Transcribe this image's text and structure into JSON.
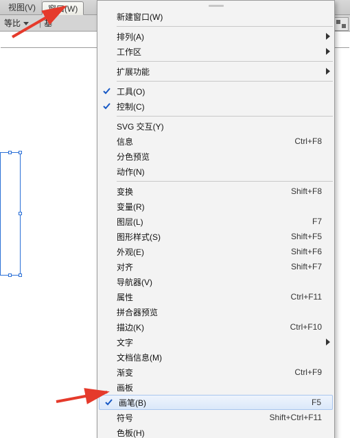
{
  "menubar": {
    "tabs": [
      {
        "label": "视图(V)",
        "active": false
      },
      {
        "label": "窗口(W)",
        "active": true
      }
    ]
  },
  "optbar": {
    "field1_label": "等比",
    "field2_label": "基"
  },
  "menu": {
    "items": [
      {
        "type": "grip"
      },
      {
        "label": "新建窗口(W)"
      },
      {
        "type": "sep"
      },
      {
        "label": "排列(A)",
        "submenu": true
      },
      {
        "label": "工作区",
        "submenu": true
      },
      {
        "type": "sep"
      },
      {
        "label": "扩展功能",
        "submenu": true
      },
      {
        "type": "sep"
      },
      {
        "label": "工具(O)",
        "checked": true
      },
      {
        "label": "控制(C)",
        "checked": true
      },
      {
        "type": "sep"
      },
      {
        "label": "SVG 交互(Y)"
      },
      {
        "label": "信息",
        "shortcut": "Ctrl+F8"
      },
      {
        "label": "分色预览"
      },
      {
        "label": "动作(N)"
      },
      {
        "type": "sep"
      },
      {
        "label": "变换",
        "shortcut": "Shift+F8"
      },
      {
        "label": "变量(R)"
      },
      {
        "label": "图层(L)",
        "shortcut": "F7"
      },
      {
        "label": "图形样式(S)",
        "shortcut": "Shift+F5"
      },
      {
        "label": "外观(E)",
        "shortcut": "Shift+F6"
      },
      {
        "label": "对齐",
        "shortcut": "Shift+F7"
      },
      {
        "label": "导航器(V)"
      },
      {
        "label": "属性",
        "shortcut": "Ctrl+F11"
      },
      {
        "label": "拼合器预览"
      },
      {
        "label": "描边(K)",
        "shortcut": "Ctrl+F10"
      },
      {
        "label": "文字",
        "submenu": true
      },
      {
        "label": "文档信息(M)"
      },
      {
        "label": "渐变",
        "shortcut": "Ctrl+F9"
      },
      {
        "label": "画板"
      },
      {
        "label": "画笔(B)",
        "shortcut": "F5",
        "checked": true,
        "highlight": true
      },
      {
        "label": "符号",
        "shortcut": "Shift+Ctrl+F11"
      },
      {
        "label": "色板(H)"
      }
    ]
  }
}
